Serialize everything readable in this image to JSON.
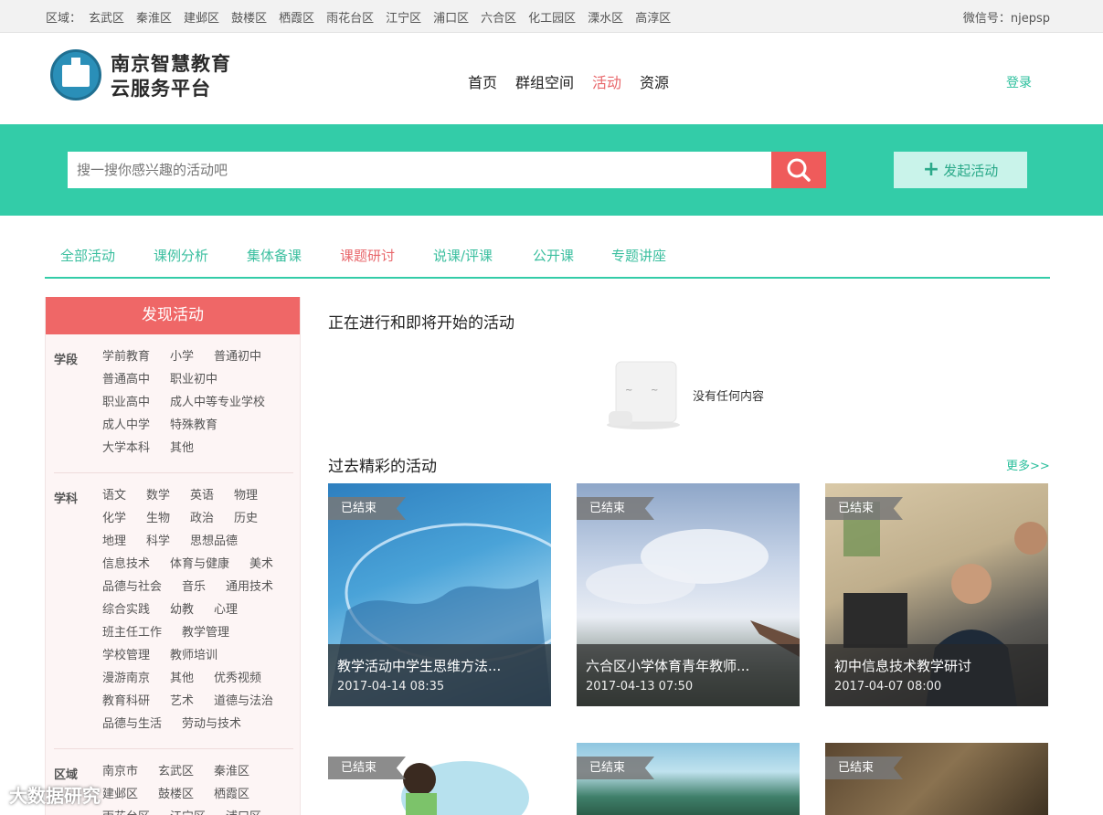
{
  "topbar": {
    "regions_label": "区域：",
    "regions": [
      "玄武区",
      "秦淮区",
      "建邺区",
      "鼓楼区",
      "栖霞区",
      "雨花台区",
      "江宁区",
      "浦口区",
      "六合区",
      "化工园区",
      "溧水区",
      "高淳区"
    ],
    "wechat": "微信号：njepsp"
  },
  "header": {
    "logo_line1": "南京智慧教育",
    "logo_line2": "云服务平台",
    "nav": [
      "首页",
      "群组空间",
      "活动",
      "资源"
    ],
    "active_nav": "活动",
    "login": "登录"
  },
  "search": {
    "placeholder": "搜一搜你感兴趣的活动吧",
    "start_label": "发起活动"
  },
  "tabs": [
    "全部活动",
    "课例分析",
    "集体备课",
    "课题研讨",
    "说课/评课",
    "公开课",
    "专题讲座"
  ],
  "active_tab": "课题研讨",
  "sidebar": {
    "title": "发现活动",
    "groups": [
      {
        "label": "学段",
        "items": [
          "学前教育",
          "小学",
          "普通初中",
          "普通高中",
          "职业初中",
          "职业高中",
          "成人中等专业学校",
          "成人中学",
          "特殊教育",
          "大学本科",
          "其他"
        ]
      },
      {
        "label": "学科",
        "items": [
          "语文",
          "数学",
          "英语",
          "物理",
          "化学",
          "生物",
          "政治",
          "历史",
          "地理",
          "科学",
          "思想品德",
          "信息技术",
          "体育与健康",
          "美术",
          "品德与社会",
          "音乐",
          "通用技术",
          "综合实践",
          "幼教",
          "心理",
          "班主任工作",
          "教学管理",
          "学校管理",
          "教师培训",
          "漫游南京",
          "其他",
          "优秀视频",
          "教育科研",
          "艺术",
          "道德与法治",
          "品德与生活",
          "劳动与技术"
        ]
      },
      {
        "label": "区域",
        "items": [
          "南京市",
          "玄武区",
          "秦淮区",
          "建邺区",
          "鼓楼区",
          "栖霞区",
          "雨花台区",
          "江宁区",
          "浦口区"
        ]
      }
    ]
  },
  "ongoing": {
    "title": "正在进行和即将开始的活动",
    "empty_text": "没有任何内容"
  },
  "past": {
    "title": "过去精彩的活动",
    "more": "更多>>",
    "status_tag": "已结束",
    "cards": [
      {
        "title": "教学活动中学生思维方法...",
        "date": "2017-04-14 08:35"
      },
      {
        "title": "六合区小学体育青年教师...",
        "date": "2017-04-13 07:50"
      },
      {
        "title": "初中信息技术教学研讨",
        "date": "2017-04-07 08:00"
      }
    ]
  },
  "watermark": "大数据研究",
  "colors": {
    "accent": "#33cca8",
    "red": "#ef5b5b",
    "active_text": "#e8676b"
  }
}
